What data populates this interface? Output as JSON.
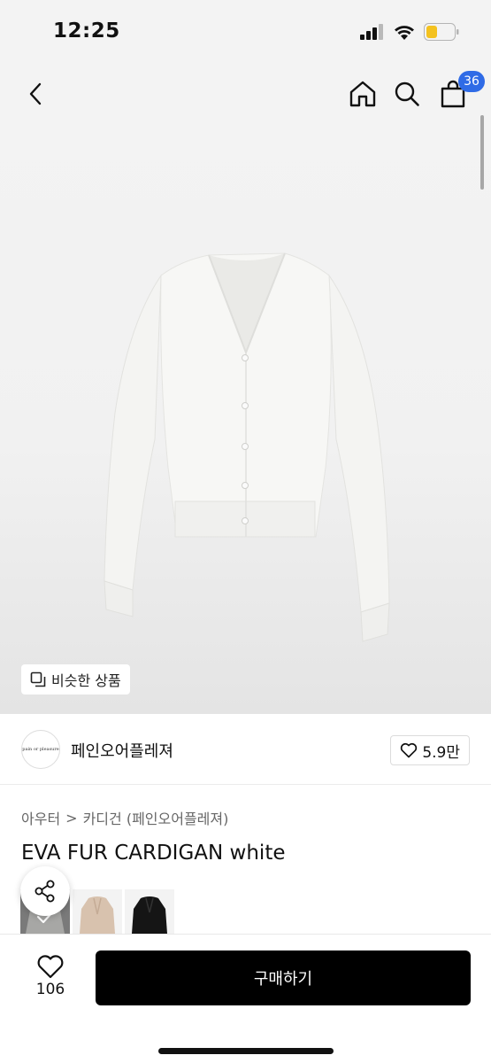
{
  "status_bar": {
    "time": "12:25"
  },
  "nav": {
    "cart_count": "36"
  },
  "hero": {
    "similar_label": "비슷한 상품"
  },
  "brand": {
    "name": "페인오어플레져",
    "logo_text": "pain or pleasure",
    "likes": "5.9만"
  },
  "breadcrumb": {
    "category": "아우터",
    "separator": ">",
    "subcategory": "카디건 (페인오어플레져)"
  },
  "product": {
    "title": "EVA FUR CARDIGAN white"
  },
  "colors": [
    {
      "name": "white",
      "hex": "#efefec",
      "selected": true
    },
    {
      "name": "beige",
      "hex": "#d8c2ae",
      "selected": false
    },
    {
      "name": "black",
      "hex": "#151515",
      "selected": false
    }
  ],
  "bottom": {
    "wish_count": "106",
    "buy_label": "구매하기"
  },
  "theme": {
    "accent": "#2f6be6",
    "button": "#000000",
    "battery": "#f4c21f"
  }
}
